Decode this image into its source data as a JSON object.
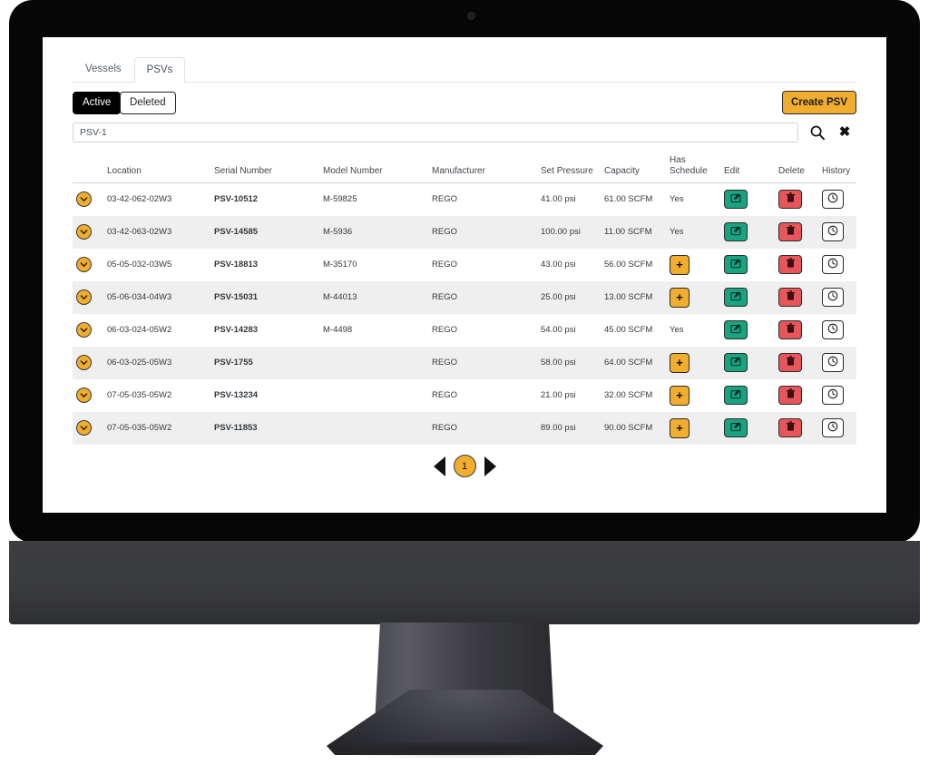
{
  "window": {
    "device": "desktop-monitor"
  },
  "tabs": [
    {
      "label": "Vessels",
      "active": false
    },
    {
      "label": "PSVs",
      "active": true
    }
  ],
  "filters": {
    "active_label": "Active",
    "deleted_label": "Deleted",
    "create_label": "Create PSV"
  },
  "search": {
    "value": "PSV-1",
    "placeholder": "Search",
    "search_icon": "search-icon",
    "clear_icon": "close-icon",
    "clear_glyph": "✖"
  },
  "table": {
    "columns": [
      "",
      "Location",
      "Serial Number",
      "Model Number",
      "Manufacturer",
      "Set Pressure",
      "Capacity",
      "Has Schedule",
      "Edit",
      "Delete",
      "History"
    ],
    "column_has_schedule_line1": "Has",
    "column_has_schedule_line2": "Schedule",
    "rows": [
      {
        "location": "03-42-062-02W3",
        "serial": "PSV-10512",
        "model": "M-59825",
        "manufacturer": "REGO",
        "set_pressure": "41.00 psi",
        "capacity": "61.00 SCFM",
        "has_schedule": "Yes",
        "has_schedule_is_button": false
      },
      {
        "location": "03-42-063-02W3",
        "serial": "PSV-14585",
        "model": "M-5936",
        "manufacturer": "REGO",
        "set_pressure": "100.00 psi",
        "capacity": "11.00 SCFM",
        "has_schedule": "Yes",
        "has_schedule_is_button": false
      },
      {
        "location": "05-05-032-03W5",
        "serial": "PSV-18813",
        "model": "M-35170",
        "manufacturer": "REGO",
        "set_pressure": "43.00 psi",
        "capacity": "56.00 SCFM",
        "has_schedule": "+",
        "has_schedule_is_button": true
      },
      {
        "location": "05-06-034-04W3",
        "serial": "PSV-15031",
        "model": "M-44013",
        "manufacturer": "REGO",
        "set_pressure": "25.00 psi",
        "capacity": "13.00 SCFM",
        "has_schedule": "+",
        "has_schedule_is_button": true
      },
      {
        "location": "06-03-024-05W2",
        "serial": "PSV-14283",
        "model": "M-4498",
        "manufacturer": "REGO",
        "set_pressure": "54.00 psi",
        "capacity": "45.00 SCFM",
        "has_schedule": "Yes",
        "has_schedule_is_button": false
      },
      {
        "location": "06-03-025-05W3",
        "serial": "PSV-1755",
        "model": "",
        "manufacturer": "REGO",
        "set_pressure": "58.00 psi",
        "capacity": "64.00 SCFM",
        "has_schedule": "+",
        "has_schedule_is_button": true
      },
      {
        "location": "07-05-035-05W2",
        "serial": "PSV-13234",
        "model": "",
        "manufacturer": "REGO",
        "set_pressure": "21.00 psi",
        "capacity": "32.00 SCFM",
        "has_schedule": "+",
        "has_schedule_is_button": true
      },
      {
        "location": "07-05-035-05W2",
        "serial": "PSV-11853",
        "model": "",
        "manufacturer": "REGO",
        "set_pressure": "89.00 psi",
        "capacity": "90.00 SCFM",
        "has_schedule": "+",
        "has_schedule_is_button": true
      }
    ],
    "icons": {
      "row_toggle": "chevron-down-icon",
      "edit": "edit-pencil-icon",
      "delete": "trash-icon",
      "history": "clock-icon",
      "add_schedule": "plus-icon"
    }
  },
  "pagination": {
    "prev_label": "◀",
    "next_label": "▶",
    "current_page": "1"
  },
  "colors": {
    "accent_yellow": "#f0ad2e",
    "edit_green": "#19a37e",
    "delete_red": "#e8555a",
    "active_black": "#000000",
    "row_stripe": "#efefef"
  }
}
